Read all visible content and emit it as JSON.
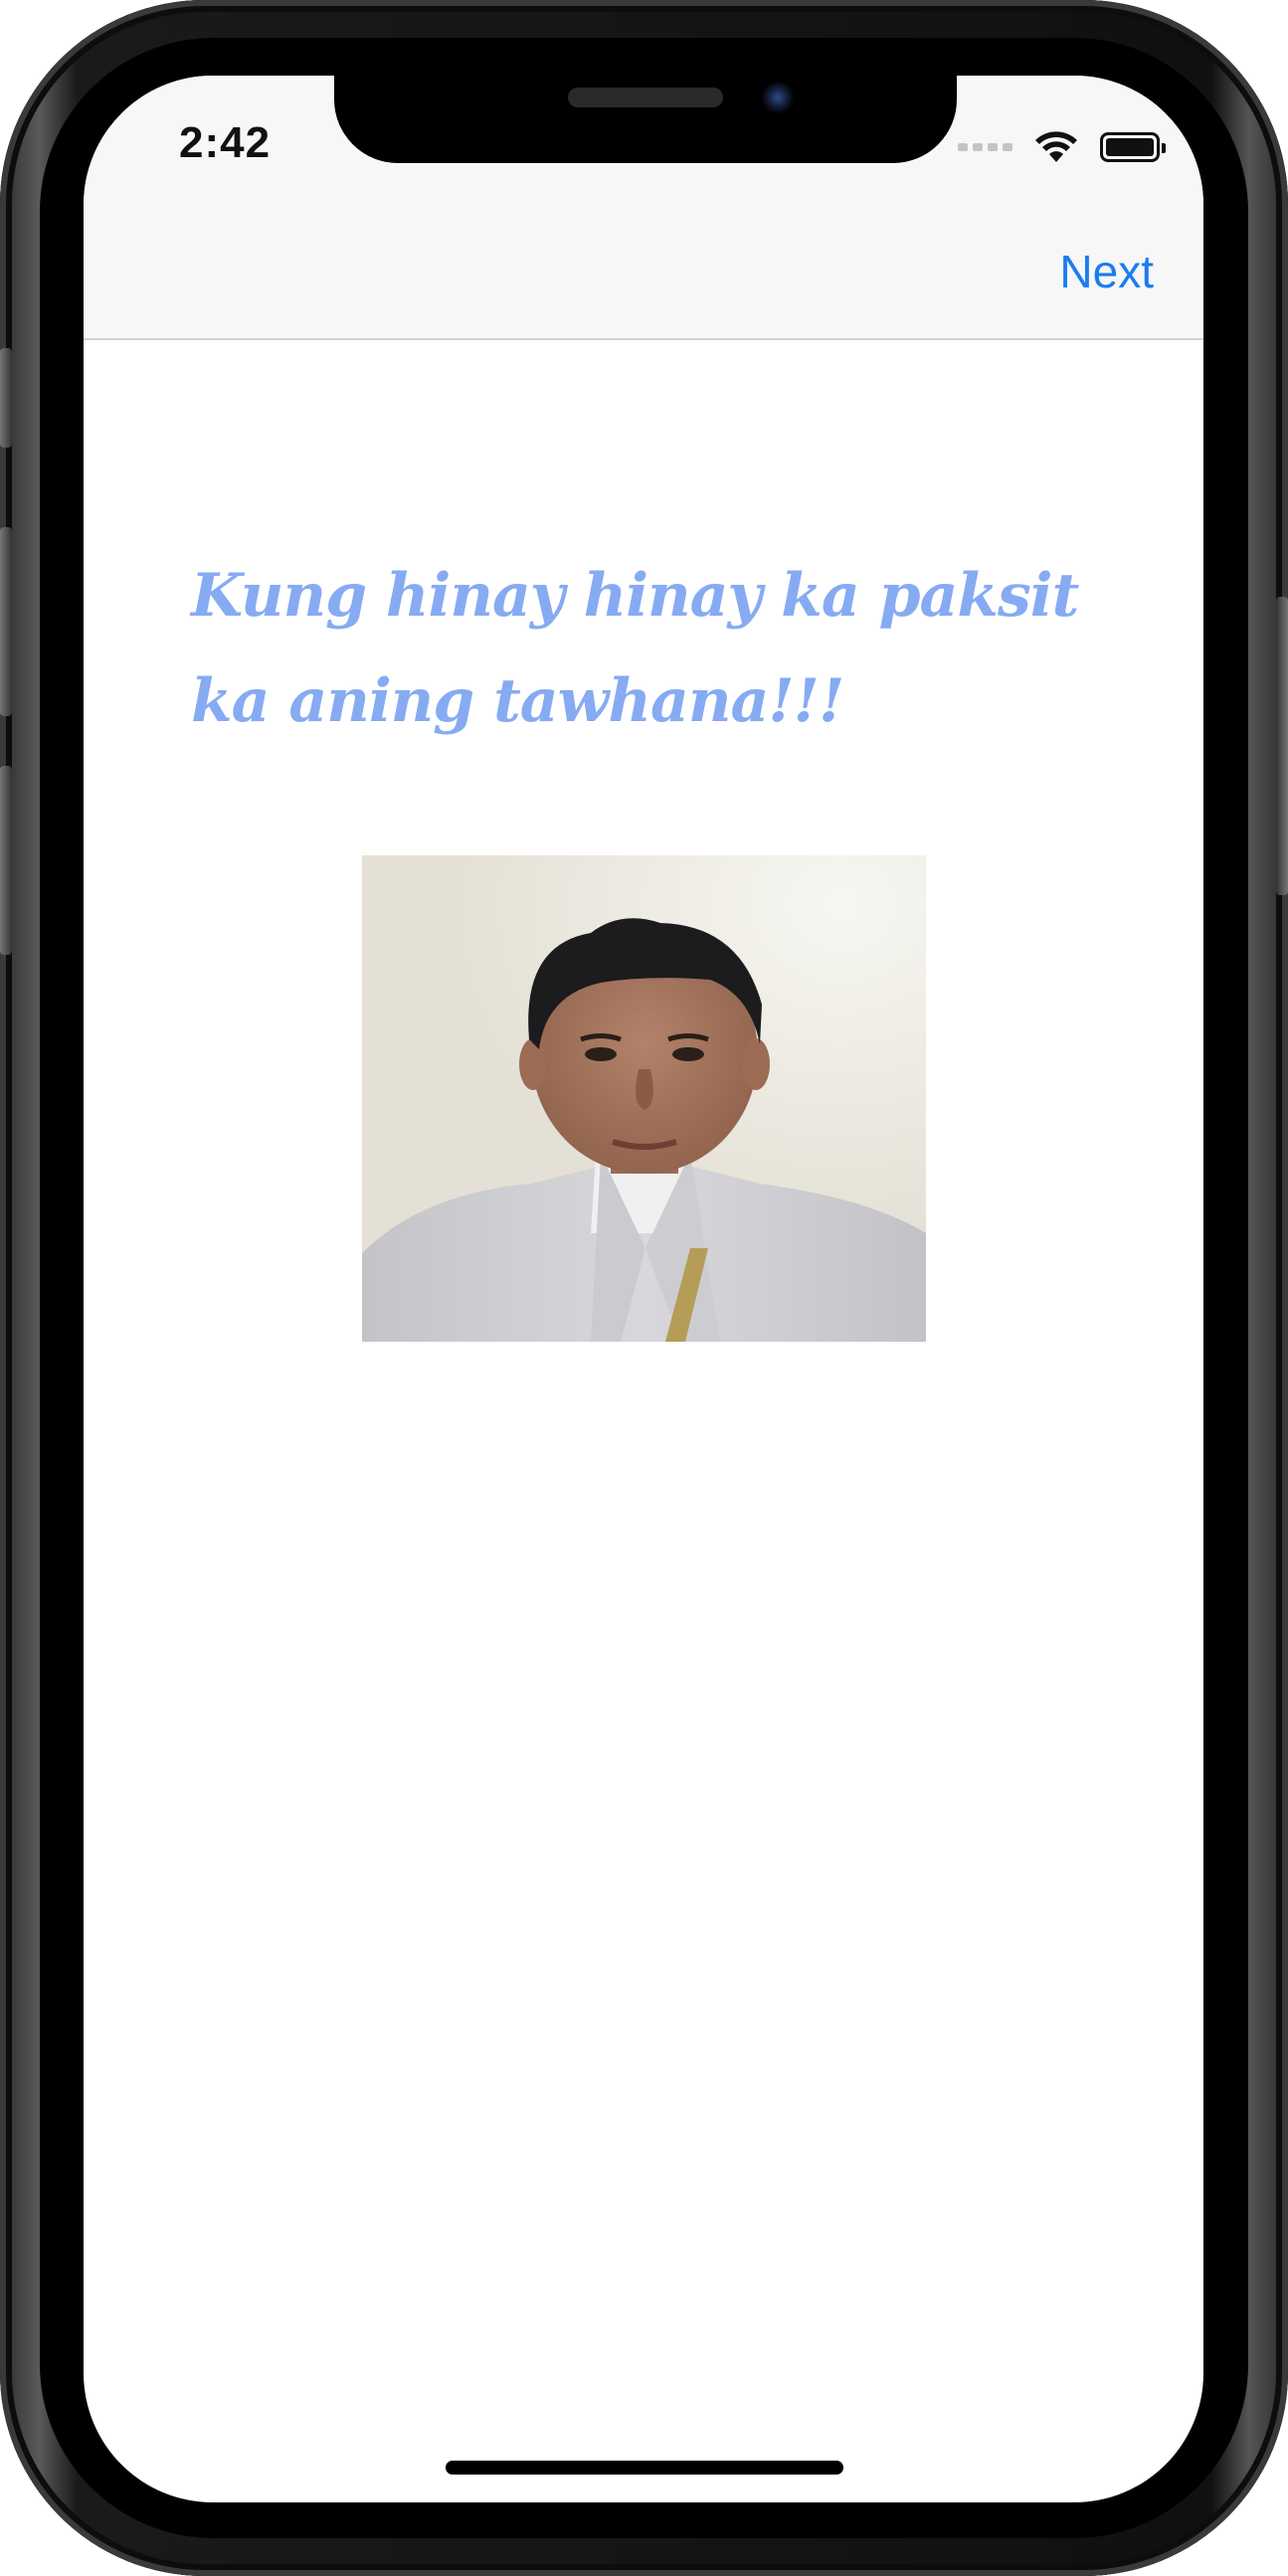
{
  "status_bar": {
    "time": "2:42",
    "icons": [
      "cellular-signal-icon",
      "wifi-icon",
      "battery-icon"
    ]
  },
  "nav_bar": {
    "next_label": "Next"
  },
  "content": {
    "quote_text": "Kung hinay hinay ka paksit ka aning tawhana!!!",
    "photo": {
      "description_icon": "profile-photo",
      "background_color": "#e6e3d9",
      "shirt_color": "#cfcfd2",
      "skin_color": "#a97a62",
      "hair_color": "#1c1b1d"
    }
  },
  "colors": {
    "accent": "#1a7cf0",
    "quote": "#86abf2",
    "navbar_bg": "#f7f7f7"
  }
}
